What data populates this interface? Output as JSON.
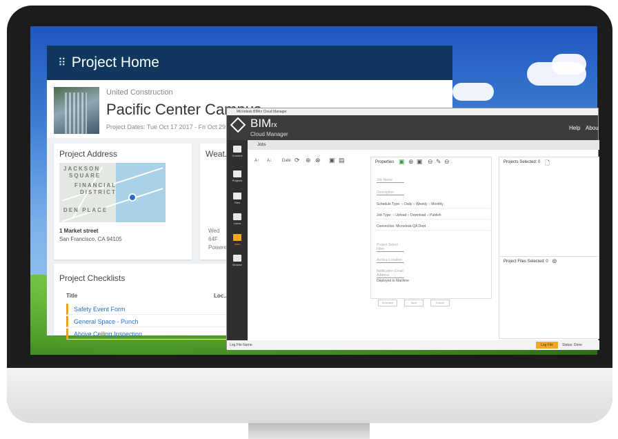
{
  "project_home": {
    "header_title": "Project Home",
    "company": "United Construction",
    "project_name": "Pacific Center Campus",
    "project_dates": "Project Dates: Tue Oct 17 2017 - Fri Oct 29 ...",
    "address_card": {
      "title": "Project Address",
      "map_labels": [
        "JACKSON",
        "SQUARE",
        "FINANCIAL",
        "DISTRICT",
        "DEN PLACE"
      ],
      "street": "1 Market street",
      "city": "San Francisco, CA 94105"
    },
    "weather_card": {
      "title": "Weat...",
      "lines": [
        "Wed",
        "64F",
        "Powered"
      ]
    },
    "checklists": {
      "title": "Project Checklists",
      "col_title": "Title",
      "col_location": "Loc...",
      "rows": [
        "Safety Event Form",
        "General Space - Punch",
        "Above Ceiling Inspection"
      ]
    }
  },
  "bimrx": {
    "window_title": "Microdesk BIMrx Cloud Manager",
    "brand": "BIM",
    "brand_suffix": "rx",
    "subtitle": "Cloud Manager",
    "menu": [
      "Help",
      "Abou"
    ],
    "rail": [
      {
        "label": "Connect",
        "icon": "shield-icon"
      },
      {
        "label": "Projects",
        "icon": "building-icon"
      },
      {
        "label": "Files",
        "icon": "folder-icon"
      },
      {
        "label": "Users",
        "icon": "users-icon"
      },
      {
        "label": "Jobs",
        "icon": "jobs-icon"
      },
      {
        "label": "Browse",
        "icon": "search-icon"
      }
    ],
    "jobs_tab": "Jobs",
    "toolbar": {
      "a_up": "A↑",
      "a_down": "A↓",
      "date": "Date"
    },
    "properties": {
      "title": "Properties",
      "job_name": "Job Name",
      "description": "Description",
      "schedule_label": "Schedule Type:",
      "schedule_opts": [
        "Daily",
        "Weekly",
        "Monthly"
      ],
      "job_type_label": "Job Type:",
      "job_type_opts": [
        "Upload",
        "Download",
        "Publish"
      ],
      "connection": "Connection: Microdesk QA Dept",
      "project_select": "Project Select Filter",
      "archive_location": "Archive Location",
      "notification": "Notification Email Address",
      "deployed": "Deployed to Machine",
      "buttons": [
        "Schedule",
        "Save",
        "Cancel"
      ]
    },
    "projects_selected": "Projects Selected: 0",
    "project_files_selected": "Project Files Selected: 0",
    "status_left": "Log File Name",
    "log_file_btn": "Log File",
    "status_right": "Status: Done"
  }
}
